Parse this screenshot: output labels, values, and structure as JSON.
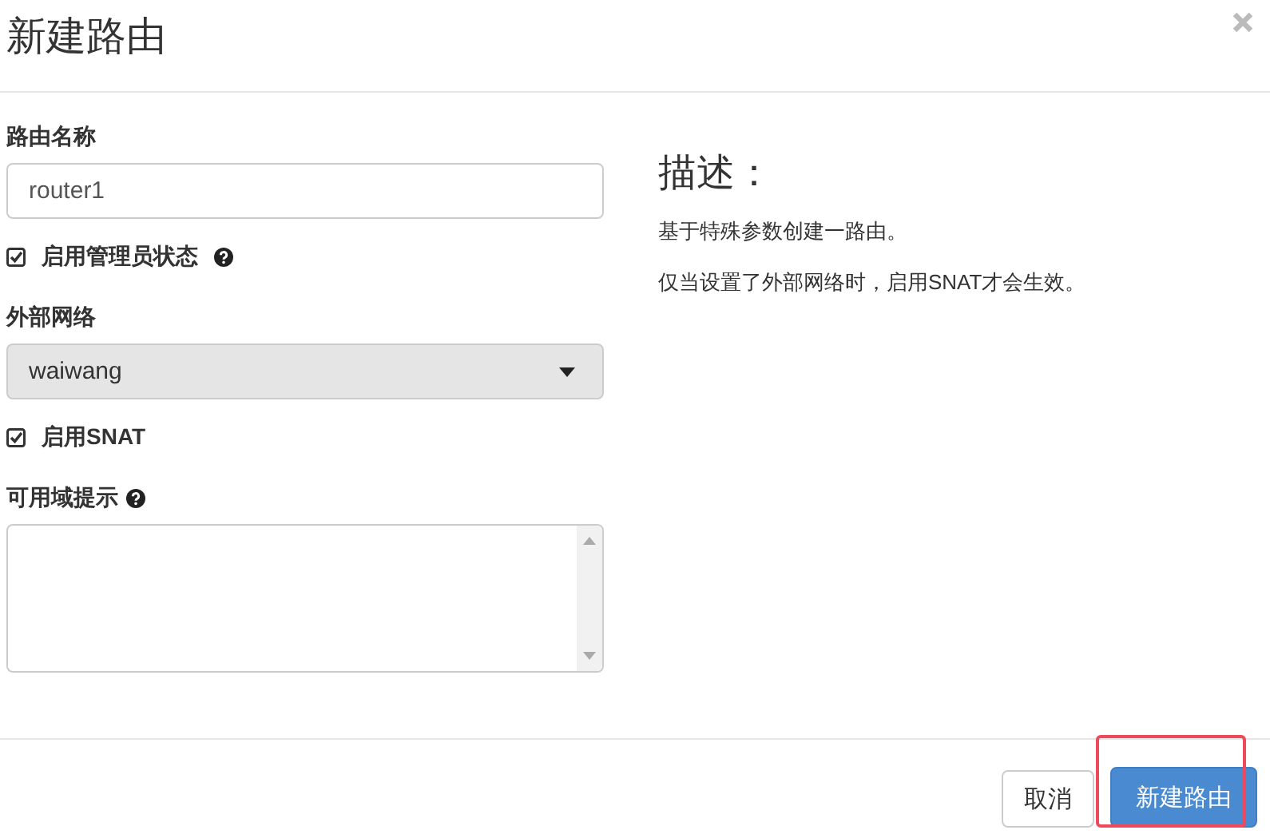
{
  "dialog": {
    "title": "新建路由"
  },
  "form": {
    "fields": [
      {
        "kind": "text",
        "label": "路由名称",
        "value": "router1"
      },
      {
        "kind": "checkbox",
        "label": "启用管理员状态",
        "checked": true,
        "help": true
      },
      {
        "kind": "select",
        "label": "外部网络",
        "value": "waiwang"
      },
      {
        "kind": "checkbox",
        "label": "启用SNAT",
        "checked": true,
        "help": false
      },
      {
        "kind": "textarea",
        "label": "可用域提示",
        "help": true
      }
    ]
  },
  "description": {
    "heading": "描述：",
    "paragraphs": [
      "基于特殊参数创建一路由。",
      "仅当设置了外部网络时，启用SNAT才会生效。"
    ]
  },
  "buttons": [
    {
      "label": "取消",
      "kind": "default",
      "highlighted": false
    },
    {
      "label": "新建路由",
      "kind": "primary",
      "highlighted": true
    }
  ]
}
